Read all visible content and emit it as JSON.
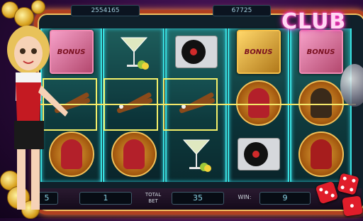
{
  "game": {
    "logo_text": "CLUB",
    "top_meters": {
      "credits": "2554165",
      "bet_total": "67725"
    },
    "bottom_panel": {
      "lines_value": "5",
      "bet_per_line": "1",
      "total_bet_label_line1": "TOTAL",
      "total_bet_label_line2": "BET",
      "total_bet_value": "35",
      "win_label": "WIN:",
      "win_value": "9"
    },
    "reels": [
      [
        "bonus-ticket",
        "drumsticks",
        "dancer-woman"
      ],
      [
        "martini-glass",
        "drumsticks",
        "dancer-woman"
      ],
      [
        "turntable",
        "drumsticks",
        "martini-glass"
      ],
      [
        "bonus-ticket",
        "dancer-woman",
        "turntable"
      ],
      [
        "bonus-ticket",
        "dancer-man",
        "dj-man"
      ]
    ],
    "symbol_texts": {
      "bonus": "BONUS",
      "bonus_gold": "BONUS"
    },
    "winning_payline": {
      "symbol": "drumsticks",
      "count": 3
    },
    "colors": {
      "reel_border": "#39e0e0",
      "win_highlight": "#f4f06a",
      "logo_glow": "#ff3fc0",
      "frame": "#b04020"
    }
  }
}
